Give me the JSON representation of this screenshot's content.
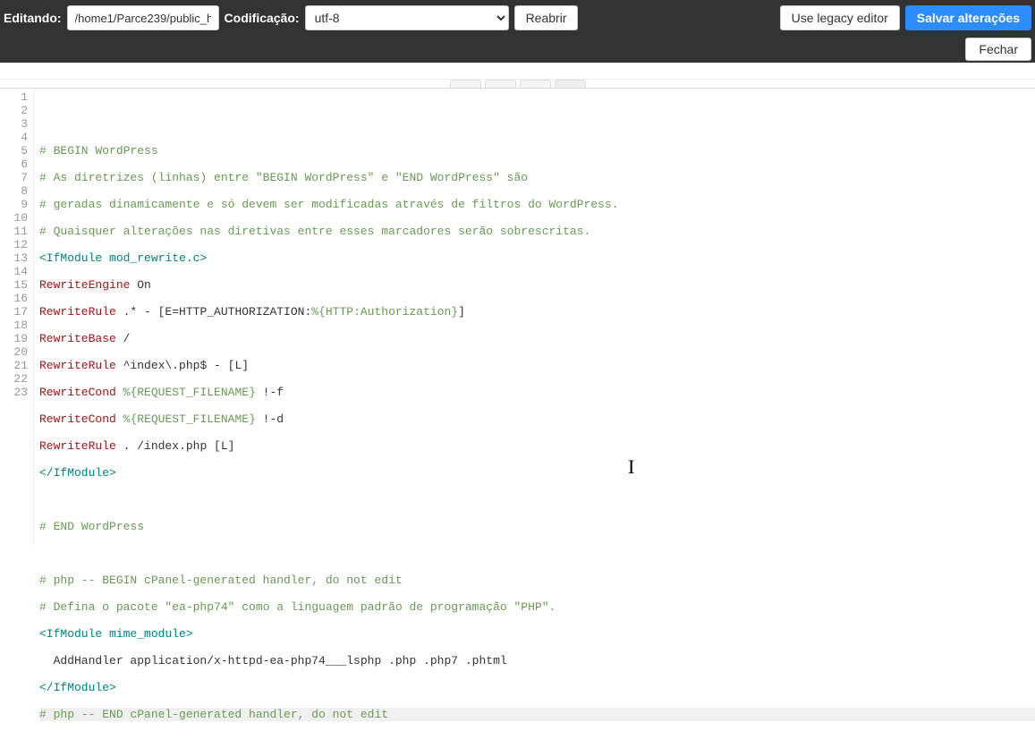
{
  "toolbar": {
    "editing_label": "Editando:",
    "file_path": "/home1/Parce239/public_h",
    "encoding_label": "Codificação:",
    "encoding_value": "utf-8",
    "reopen_label": "Reabrir",
    "legacy_label": "Use legacy editor",
    "save_label": "Salvar alterações",
    "close_label": "Fechar"
  },
  "tabs": {
    "arrow_icon": "↔"
  },
  "lines": [
    {
      "n": 1,
      "segs": [
        [
          "",
          ""
        ]
      ]
    },
    {
      "n": 2,
      "segs": [
        [
          "comment",
          "# BEGIN WordPress"
        ]
      ]
    },
    {
      "n": 3,
      "segs": [
        [
          "comment",
          "# As diretrizes (linhas) entre \"BEGIN WordPress\" e \"END WordPress\" são"
        ]
      ]
    },
    {
      "n": 4,
      "segs": [
        [
          "comment",
          "# geradas dinamicamente e só devem ser modificadas através de filtros do WordPress."
        ]
      ]
    },
    {
      "n": 5,
      "segs": [
        [
          "comment",
          "# Quaisquer alterações nas diretivas entre esses marcadores serão sobrescritas."
        ]
      ]
    },
    {
      "n": 6,
      "segs": [
        [
          "tag",
          "<IfModule"
        ],
        [
          "",
          " "
        ],
        [
          "attr",
          "mod_rewrite.c"
        ],
        [
          "tag",
          ">"
        ]
      ]
    },
    {
      "n": 7,
      "segs": [
        [
          "keyword",
          "RewriteEngine"
        ],
        [
          "",
          " On"
        ]
      ]
    },
    {
      "n": 8,
      "segs": [
        [
          "keyword",
          "RewriteRule"
        ],
        [
          "",
          " .* - [E=HTTP_AUTHORIZATION:"
        ],
        [
          "env",
          "%{HTTP:Authorization}"
        ],
        [
          "",
          "]"
        ]
      ]
    },
    {
      "n": 9,
      "segs": [
        [
          "keyword",
          "RewriteBase"
        ],
        [
          "",
          " /"
        ]
      ]
    },
    {
      "n": 10,
      "segs": [
        [
          "keyword",
          "RewriteRule"
        ],
        [
          "",
          " ^index\\.php$ - [L]"
        ]
      ]
    },
    {
      "n": 11,
      "segs": [
        [
          "keyword",
          "RewriteCond"
        ],
        [
          "",
          " "
        ],
        [
          "env",
          "%{REQUEST_FILENAME}"
        ],
        [
          "",
          " !-f"
        ]
      ]
    },
    {
      "n": 12,
      "segs": [
        [
          "keyword",
          "RewriteCond"
        ],
        [
          "",
          " "
        ],
        [
          "env",
          "%{REQUEST_FILENAME}"
        ],
        [
          "",
          " !-d"
        ]
      ]
    },
    {
      "n": 13,
      "segs": [
        [
          "keyword",
          "RewriteRule"
        ],
        [
          "",
          " . /index.php [L]"
        ]
      ]
    },
    {
      "n": 14,
      "segs": [
        [
          "tag",
          "</IfModule>"
        ]
      ]
    },
    {
      "n": 15,
      "segs": [
        [
          "",
          ""
        ]
      ]
    },
    {
      "n": 16,
      "segs": [
        [
          "comment",
          "# END WordPress"
        ]
      ]
    },
    {
      "n": 17,
      "segs": [
        [
          "",
          ""
        ]
      ]
    },
    {
      "n": 18,
      "segs": [
        [
          "comment",
          "# php -- BEGIN cPanel-generated handler, do not edit"
        ]
      ]
    },
    {
      "n": 19,
      "segs": [
        [
          "comment",
          "# Defina o pacote \"ea-php74\" como a linguagem padrão de programação \"PHP\"."
        ]
      ]
    },
    {
      "n": 20,
      "segs": [
        [
          "tag",
          "<IfModule"
        ],
        [
          "",
          " "
        ],
        [
          "attr",
          "mime_module"
        ],
        [
          "tag",
          ">"
        ]
      ]
    },
    {
      "n": 21,
      "segs": [
        [
          "",
          "  AddHandler application/x-httpd-ea-php74___lsphp .php .php7 .phtml"
        ]
      ]
    },
    {
      "n": 22,
      "segs": [
        [
          "tag",
          "</IfModule>"
        ]
      ]
    },
    {
      "n": 23,
      "segs": [
        [
          "comment",
          "# php -- END cPanel-generated handler, do not edit"
        ]
      ],
      "highlight": true
    }
  ]
}
